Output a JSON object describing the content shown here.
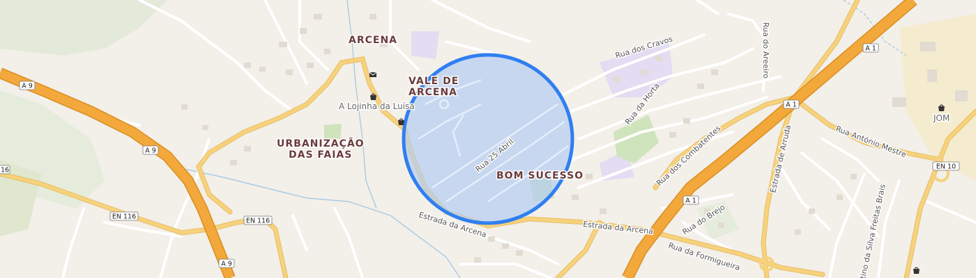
{
  "map": {
    "places": {
      "arcena": "ARCENA",
      "vale_de_arcena_1": "VALE DE",
      "vale_de_arcena_2": "ARCENA",
      "urbanizacao_1": "URBANIZAÇÃO",
      "urbanizacao_2": "DAS FAIAS",
      "bom_sucesso": "BOM SUCESSO"
    },
    "streets": {
      "rua_dos_cravos": "Rua dos Cravos",
      "rua_do_areeiro": "Rua do Areeiro",
      "rua_da_horta": "Rua da Horta",
      "rua_25_abril": "Rua 25 Abril",
      "rua_dos_combatentes": "Rua dos Combatentes",
      "rua_antonio_mestre": "Rua António Mestre",
      "estrada_de_arruda": "Estrada de Arruda",
      "estrada_da_arcena_1": "Estrada da Arcena",
      "estrada_da_arcena_2": "Estrada da Arcena",
      "rua_do_brejo": "Rua do Brejo",
      "rua_da_formigueira": "Rua da Formigueira",
      "silva_freitas_brais": "tino da Silva Freitas Brais"
    },
    "shields": {
      "a9_top": "A 9",
      "a9_mid": "A 9",
      "a9_bottom": "A 9",
      "road_116_left": "116",
      "en116_a": "EN 116",
      "en116_b": "EN 116",
      "a1_top": "A 1",
      "a1_mid": "A 1",
      "a1_bottom": "A 1",
      "en10": "EN 10"
    },
    "pois": {
      "lojinha": "A Lojinha da Luísa",
      "jom": "JOM"
    },
    "highlight": {
      "fill": "#b4cdf2",
      "stroke": "#2f7ff0"
    },
    "colors": {
      "background": "#f3efe9",
      "motorway": "#f2a83a",
      "primary_road": "#f7d27c",
      "minor_road": "#ffffff",
      "water": "#9cc6e3",
      "park": "#cfe3bd",
      "school": "#e3dcf2",
      "forest": "#e4ead9"
    },
    "icons": [
      "mail-icon",
      "shop-icon",
      "shop-icon",
      "shop-icon",
      "shop-icon"
    ]
  }
}
